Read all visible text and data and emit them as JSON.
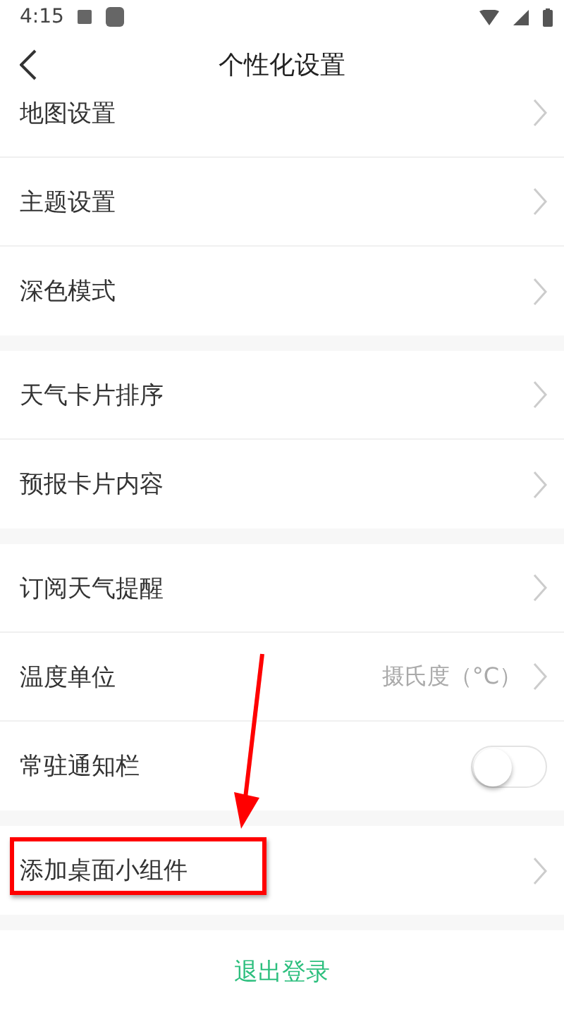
{
  "status_bar": {
    "time": "4:15"
  },
  "header": {
    "title": "个性化设置"
  },
  "groups": [
    {
      "rows": [
        {
          "kind": "link",
          "label": "地图设置"
        },
        {
          "kind": "link",
          "label": "主题设置"
        },
        {
          "kind": "link",
          "label": "深色模式"
        }
      ]
    },
    {
      "rows": [
        {
          "kind": "link",
          "label": "天气卡片排序"
        },
        {
          "kind": "link",
          "label": "预报卡片内容"
        }
      ]
    },
    {
      "rows": [
        {
          "kind": "link",
          "label": "订阅天气提醒"
        },
        {
          "kind": "value",
          "label": "温度单位",
          "value": "摄氏度（°C）"
        },
        {
          "kind": "switch",
          "label": "常驻通知栏",
          "on": false
        }
      ]
    },
    {
      "rows": [
        {
          "kind": "link",
          "label": "添加桌面小组件",
          "highlighted": true
        }
      ]
    }
  ],
  "logout": "退出登录"
}
